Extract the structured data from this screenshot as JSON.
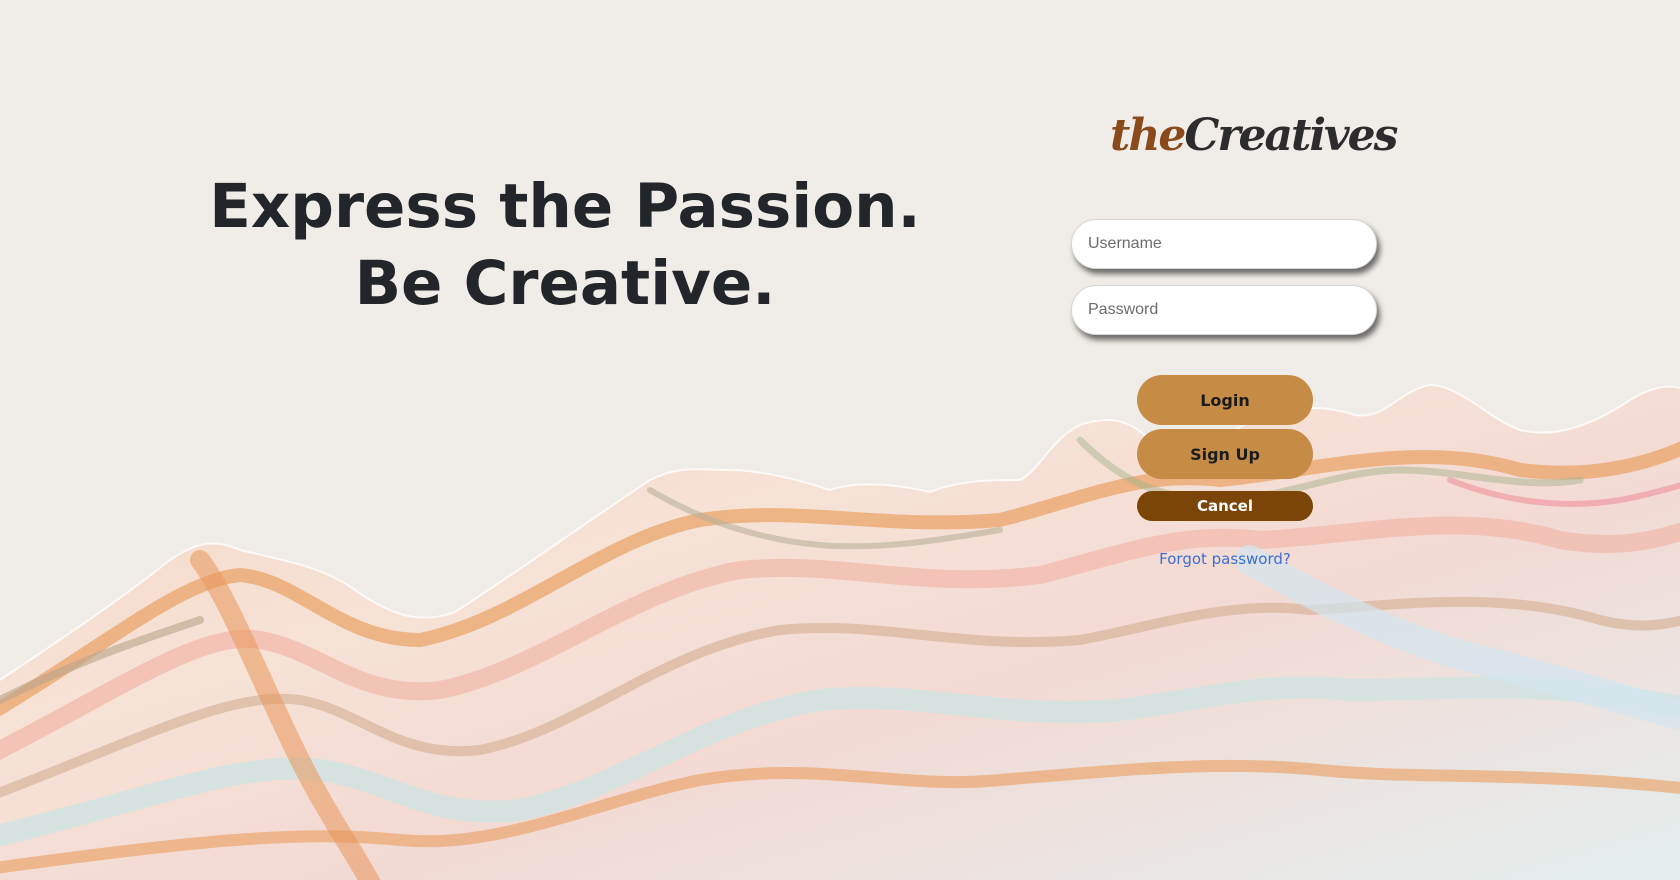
{
  "hero": {
    "headline": "Express the Passion. Be Creative."
  },
  "brand": {
    "logo_part1": "the",
    "logo_part2": "Creatives"
  },
  "form": {
    "username_placeholder": "Username",
    "password_placeholder": "Password",
    "login_label": "Login",
    "signup_label": "Sign Up",
    "cancel_label": "Cancel",
    "forgot_label": "Forgot password?"
  },
  "colors": {
    "background": "#f0ece7",
    "primary_button": "#c68c45",
    "cancel_button": "#7a4507",
    "link": "#3d6fd0",
    "headline": "#22252a"
  },
  "icons": {
    "background_art": "marbled-mountains-illustration"
  }
}
